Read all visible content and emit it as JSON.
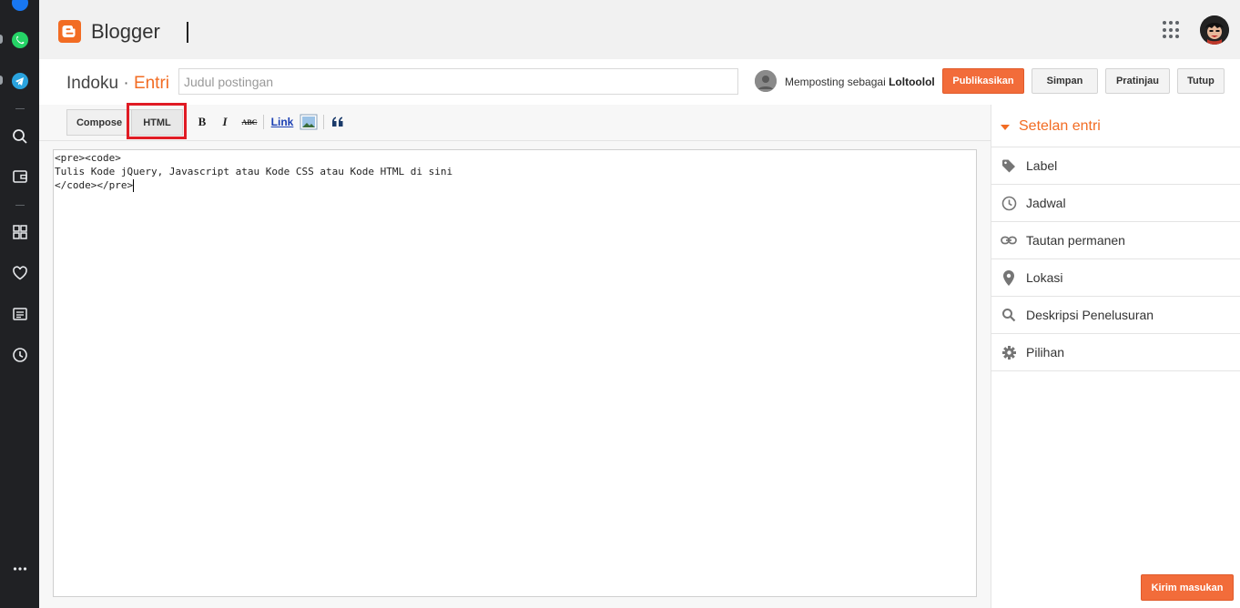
{
  "app": {
    "name": "Blogger"
  },
  "header": {
    "blog_name": "Indoku",
    "separator": "·",
    "section": "Entri",
    "title_placeholder": "Judul postingan",
    "posting_as_prefix": "Memposting sebagai",
    "posting_as_user": "Loltoolol",
    "buttons": {
      "publish": "Publikasikan",
      "save": "Simpan",
      "preview": "Pratinjau",
      "close": "Tutup"
    }
  },
  "toolbar": {
    "compose": "Compose",
    "html": "HTML",
    "bold": "B",
    "italic": "I",
    "strike": "ABC",
    "link": "Link"
  },
  "editor": {
    "lines": [
      "<pre><code>",
      "Tulis Kode jQuery, Javascript atau Kode CSS atau Kode HTML di sini",
      "</code></pre>"
    ]
  },
  "sidebar": {
    "title": "Setelan entri",
    "items": [
      {
        "label": "Label",
        "icon": "tag-icon"
      },
      {
        "label": "Jadwal",
        "icon": "clock-icon"
      },
      {
        "label": "Tautan permanen",
        "icon": "link-icon"
      },
      {
        "label": "Lokasi",
        "icon": "location-pin-icon"
      },
      {
        "label": "Deskripsi Penelusuran",
        "icon": "search-icon"
      },
      {
        "label": "Pilihan",
        "icon": "gear-icon"
      }
    ]
  },
  "feedback": {
    "label": "Kirim masukan"
  },
  "colors": {
    "accent": "#f26c23",
    "button_primary": "#f26c3a",
    "highlight": "#e01b24",
    "rail": "#202124"
  }
}
